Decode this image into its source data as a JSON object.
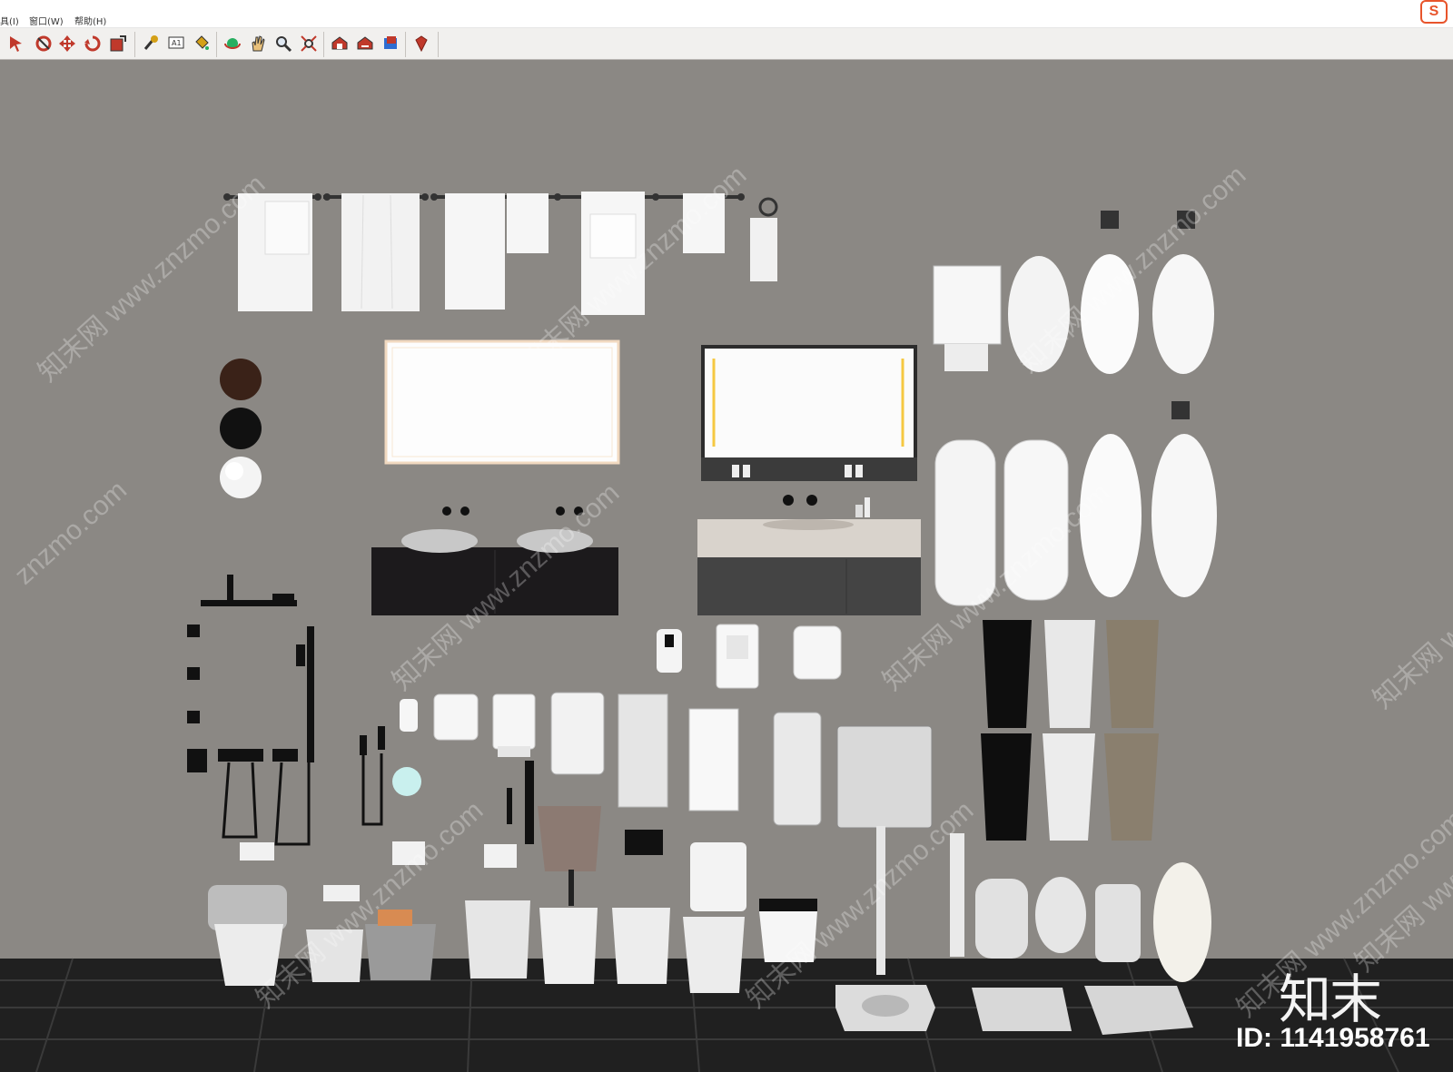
{
  "menu": {
    "items": [
      {
        "label": "具(I)"
      },
      {
        "label": "窗口(W)"
      },
      {
        "label": "帮助(H)"
      }
    ]
  },
  "app_logo": "S",
  "toolbar": {
    "tools": [
      {
        "icon": "select-arrow-icon",
        "color": "#c0392b"
      },
      {
        "icon": "orbit-icon",
        "color": "#c0392b"
      },
      {
        "icon": "move-icon",
        "color": "#c0392b"
      },
      {
        "icon": "rotate-icon",
        "color": "#c0392b"
      },
      {
        "icon": "scale-icon",
        "color": "#c0392b"
      },
      {
        "icon": "tape-measure-icon",
        "color": "#d4a017"
      },
      {
        "icon": "text-icon",
        "color": "#333333"
      },
      {
        "icon": "paint-bucket-icon",
        "color": "#d4a017"
      },
      {
        "icon": "orbit-camera-icon",
        "color": "#27ae60"
      },
      {
        "icon": "pan-hand-icon",
        "color": "#d4a017"
      },
      {
        "icon": "zoom-icon",
        "color": "#333333"
      },
      {
        "icon": "zoom-extents-icon",
        "color": "#c0392b"
      },
      {
        "icon": "warehouse-icon",
        "color": "#c0392b"
      },
      {
        "icon": "share-model-icon",
        "color": "#c0392b"
      },
      {
        "icon": "extension-icon",
        "color": "#c0392b"
      },
      {
        "icon": "ruby-gem-icon",
        "color": "#c0392b"
      }
    ]
  },
  "watermarks": [
    {
      "text": "知末网 www.znzmo.com"
    },
    {
      "text": "知末网 www.znzmo.com"
    },
    {
      "text": "知末网 www.znzmo.com"
    },
    {
      "text": "znzmo.com"
    },
    {
      "text": "知末网 www.znzmo.com"
    },
    {
      "text": "知末网 www.znzmo.com"
    },
    {
      "text": "知末网 www.znzmo.com"
    },
    {
      "text": "知末网 www.znzmo.com"
    },
    {
      "text": "知末网 www.znzmo.com"
    },
    {
      "text": "知末网 www.znzmo.com"
    },
    {
      "text": "知末网 www.znzmo.com"
    }
  ],
  "brand": "知末",
  "id_label": "ID: 1141958761",
  "colors": {
    "wall": "#8b8884",
    "floor": "#222222",
    "porcelain": "#ececec",
    "fixture_black": "#111111",
    "mirror_light": "#fff6e3"
  }
}
